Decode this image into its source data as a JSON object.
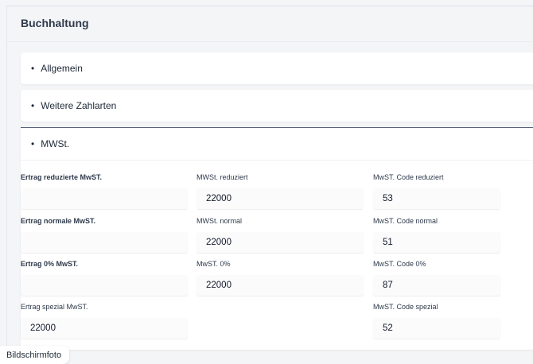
{
  "panel": {
    "title": "Buchhaltung"
  },
  "sections": {
    "allgemein": {
      "label": "Allgemein"
    },
    "zahlarten": {
      "label": "Weitere Zahlarten"
    },
    "mwst": {
      "label": "MWSt."
    }
  },
  "bullet": "•",
  "form": {
    "row1": {
      "ertrag": {
        "label": "Ertrag reduzierte MwST.",
        "value": ""
      },
      "mwst": {
        "label": "MWSt. reduziert",
        "value": "22000"
      },
      "code": {
        "label": "MwST. Code reduziert",
        "value": "53"
      }
    },
    "row2": {
      "ertrag": {
        "label": "Ertrag normale MwST.",
        "value": ""
      },
      "mwst": {
        "label": "MWSt. normal",
        "value": "22000"
      },
      "code": {
        "label": "MwST. Code normal",
        "value": "51"
      }
    },
    "row3": {
      "ertrag": {
        "label": "Ertrag 0% MwST.",
        "value": ""
      },
      "mwst": {
        "label": "MwST. 0%",
        "value": "22000"
      },
      "code": {
        "label": "MwST. Code 0%",
        "value": "87"
      }
    },
    "row4": {
      "ertrag": {
        "label": "Ertrag spezial MwST.",
        "value": "22000"
      },
      "code": {
        "label": "MwST. Code spezial",
        "value": "52"
      }
    }
  },
  "toast": {
    "label": "Bildschirmfoto"
  }
}
